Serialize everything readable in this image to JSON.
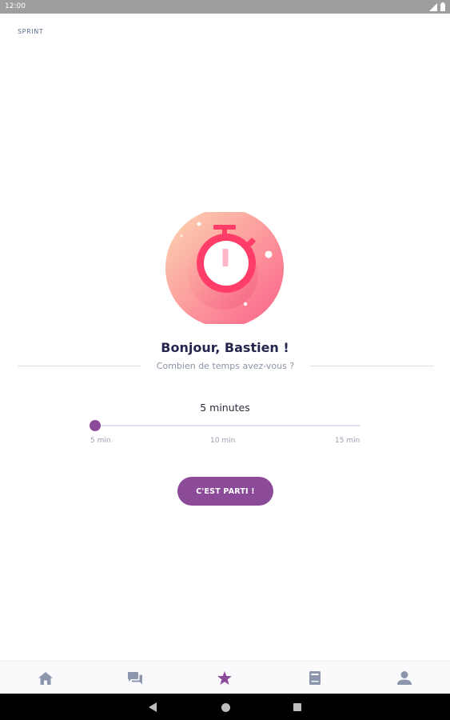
{
  "status_bar": {
    "time": "12:00",
    "icons": [
      "signal-icon",
      "battery-icon"
    ]
  },
  "header": {
    "label": "SPRINT"
  },
  "hero": {
    "icon": "stopwatch-icon",
    "colors": {
      "gradient_start": "#fcd0ad",
      "gradient_end": "#fb6d8d",
      "stopwatch": "#ff3d68"
    }
  },
  "greeting": "Bonjour, Bastien !",
  "subtitle": "Combien de temps avez-vous ?",
  "duration": {
    "selected_label": "5 minutes",
    "min": 5,
    "max": 15,
    "value": 5,
    "ticks": [
      "5 min",
      "10 min",
      "15 min"
    ]
  },
  "start_button": {
    "label": "C'EST PARTI !"
  },
  "bottom_nav": {
    "items": [
      {
        "icon": "home-icon",
        "active": false
      },
      {
        "icon": "chat-icon",
        "active": false
      },
      {
        "icon": "star-icon",
        "active": true
      },
      {
        "icon": "book-icon",
        "active": false
      },
      {
        "icon": "profile-icon",
        "active": false
      }
    ]
  },
  "system_nav": {
    "buttons": [
      "back-icon",
      "home-circle-icon",
      "recents-icon"
    ]
  },
  "colors": {
    "accent": "#8c4b99",
    "nav_inactive": "#8c97ad",
    "text_dark": "#25264d",
    "text_muted": "#8a93a8"
  }
}
